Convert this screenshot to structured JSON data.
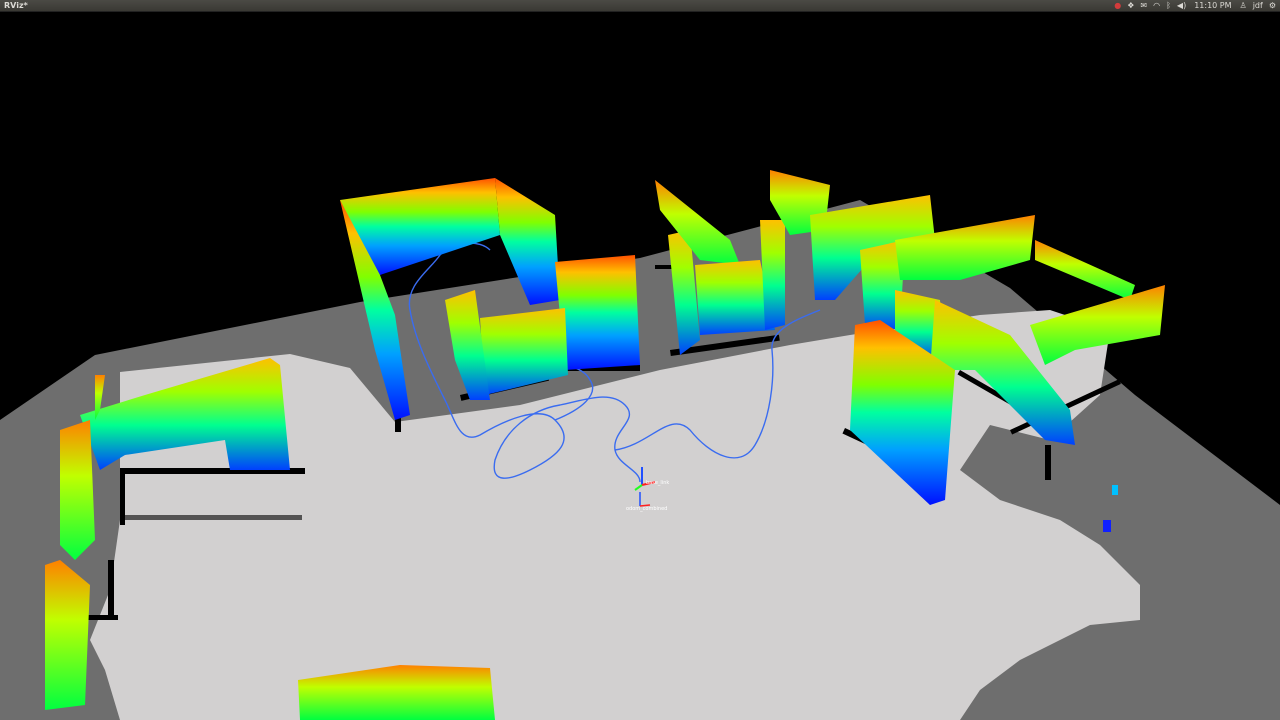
{
  "window": {
    "title": "RViz*"
  },
  "tray": {
    "icons": [
      "record-icon",
      "dropbox-icon",
      "mail-icon",
      "wifi-icon",
      "bluetooth-icon",
      "volume-icon"
    ],
    "clock": "11:10 PM",
    "user": "jdf"
  },
  "scene": {
    "background": "#000000",
    "map_unknown_color": "#6e6e6e",
    "map_free_color": "#d2d0d0",
    "map_occupied_color": "#000000",
    "path_color": "#3a6cf0",
    "colormap": [
      "#0010ff",
      "#00a0ff",
      "#00ffc0",
      "#40ff40",
      "#c0ff00",
      "#ffc000",
      "#ff5000"
    ],
    "frames": [
      {
        "label": "base_link"
      },
      {
        "label": "odom_combined"
      }
    ]
  }
}
